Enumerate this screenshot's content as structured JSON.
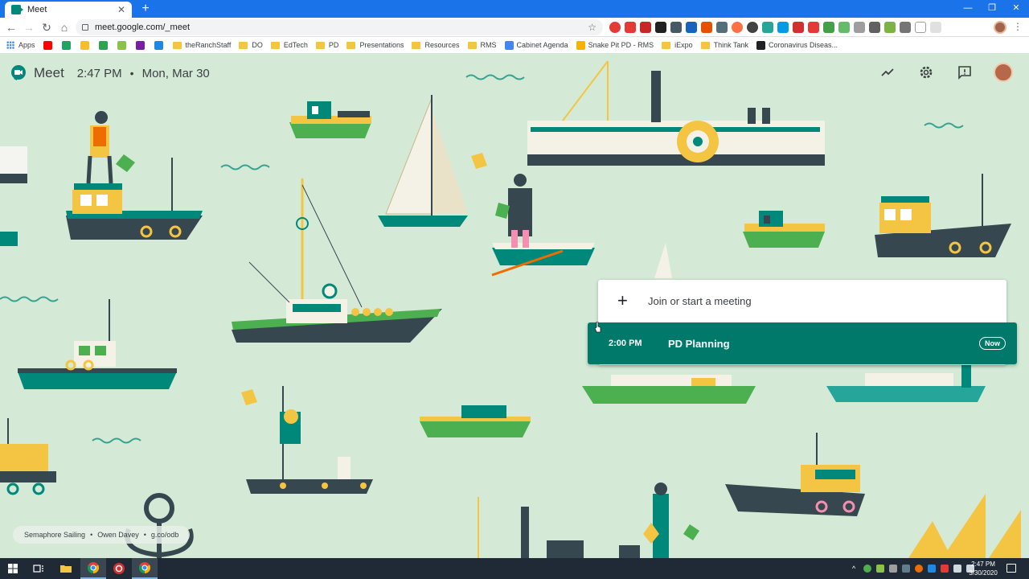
{
  "browser": {
    "tab_title": "Meet",
    "tab_close": "✕",
    "new_tab": "+",
    "window_controls": {
      "minimize": "—",
      "restore": "❐",
      "close": "✕"
    },
    "nav": {
      "back": "←",
      "forward": "→",
      "reload": "↻",
      "home": "⌂"
    },
    "url": "meet.google.com/_meet",
    "star": "☆",
    "menu": "⋮"
  },
  "bookmarks": [
    {
      "label": "Apps",
      "icon": "apps-grid-icon"
    },
    {
      "label": "",
      "icon": "youtube-icon",
      "color": "#ff0000"
    },
    {
      "label": "",
      "icon": "drive-icon",
      "color": "#1fa463"
    },
    {
      "label": "",
      "icon": "keep-icon",
      "color": "#f6bf26"
    },
    {
      "label": "",
      "icon": "classroom-icon",
      "color": "#2da44e"
    },
    {
      "label": "",
      "icon": "sheets-icon",
      "color": "#8bc34a"
    },
    {
      "label": "",
      "icon": "p-icon",
      "color": "#7b1fa2"
    },
    {
      "label": "",
      "icon": "b-icon",
      "color": "#1e88e5"
    },
    {
      "label": "theRanchStaff",
      "icon": "folder-icon"
    },
    {
      "label": "DO",
      "icon": "folder-icon"
    },
    {
      "label": "EdTech",
      "icon": "folder-icon"
    },
    {
      "label": "PD",
      "icon": "folder-icon"
    },
    {
      "label": "Presentations",
      "icon": "folder-icon"
    },
    {
      "label": "Resources",
      "icon": "folder-icon"
    },
    {
      "label": "RMS",
      "icon": "folder-icon"
    },
    {
      "label": "Cabinet Agenda",
      "icon": "docs-icon",
      "color": "#4285f4"
    },
    {
      "label": "Snake Pit PD - RMS",
      "icon": "slides-icon",
      "color": "#f4b400"
    },
    {
      "label": "iExpo",
      "icon": "folder-icon"
    },
    {
      "label": "Think Tank",
      "icon": "folder-icon"
    },
    {
      "label": "Coronavirus Diseas...",
      "icon": "virus-icon",
      "color": "#202124"
    }
  ],
  "meet": {
    "brand": "Meet",
    "time": "2:47 PM",
    "dot": "•",
    "date": "Mon, Mar 30",
    "join_plus": "+",
    "join_label": "Join or start a meeting",
    "meeting": {
      "time": "2:00 PM",
      "title": "PD Planning",
      "badge": "Now"
    },
    "credit": {
      "title": "Semaphore Sailing",
      "sep": "•",
      "artist": "Owen Davey",
      "link": "g.co/odb"
    },
    "colors": {
      "background": "#d4ead6",
      "accent": "#00796b",
      "boat_green": "#00897b",
      "boat_yellow": "#f4c542",
      "boat_dark": "#37474f"
    }
  },
  "taskbar": {
    "time": "2:47 PM",
    "date": "3/30/2020"
  }
}
